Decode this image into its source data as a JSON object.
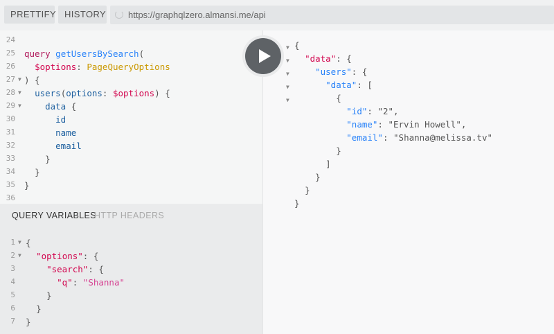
{
  "toolbar": {
    "prettify_label": "PRETTIFY",
    "history_label": "HISTORY",
    "url": "https://graphqlzero.almansi.me/api"
  },
  "editor": {
    "lines": [
      {
        "n": "24",
        "text": ""
      },
      {
        "n": "25",
        "text": "query getUsersBySearch("
      },
      {
        "n": "26",
        "text": "  $options: PageQueryOptions"
      },
      {
        "n": "27",
        "text": ") {"
      },
      {
        "n": "28",
        "text": "  users(options: $options) {"
      },
      {
        "n": "29",
        "text": "    data {"
      },
      {
        "n": "30",
        "text": "      id"
      },
      {
        "n": "31",
        "text": "      name"
      },
      {
        "n": "32",
        "text": "      email"
      },
      {
        "n": "33",
        "text": "    }"
      },
      {
        "n": "34",
        "text": "  }"
      },
      {
        "n": "35",
        "text": "}"
      },
      {
        "n": "36",
        "text": ""
      }
    ]
  },
  "variables": {
    "tab_query_variables": "QUERY VARIABLES",
    "tab_http_headers": "HTTP HEADERS",
    "lines": [
      {
        "n": "1",
        "text": "{"
      },
      {
        "n": "2",
        "text": "  \"options\": {"
      },
      {
        "n": "3",
        "text": "    \"search\": {"
      },
      {
        "n": "4",
        "text": "      \"q\": \"Shanna\""
      },
      {
        "n": "5",
        "text": "    }"
      },
      {
        "n": "6",
        "text": "  }"
      },
      {
        "n": "7",
        "text": "}"
      }
    ]
  },
  "result": {
    "lines": [
      "{",
      "  \"data\": {",
      "    \"users\": {",
      "      \"data\": [",
      "        {",
      "          \"id\": \"2\",",
      "          \"name\": \"Ervin Howell\",",
      "          \"email\": \"Shanna@melissa.tv\"",
      "        }",
      "      ]",
      "    }",
      "  }",
      "}"
    ]
  },
  "colors": {
    "keyword": "#b11a5b",
    "definition": "#2882f9",
    "variable": "#d2054e",
    "type": "#ca9800",
    "property": "#1f61a0",
    "string": "#d64292"
  }
}
